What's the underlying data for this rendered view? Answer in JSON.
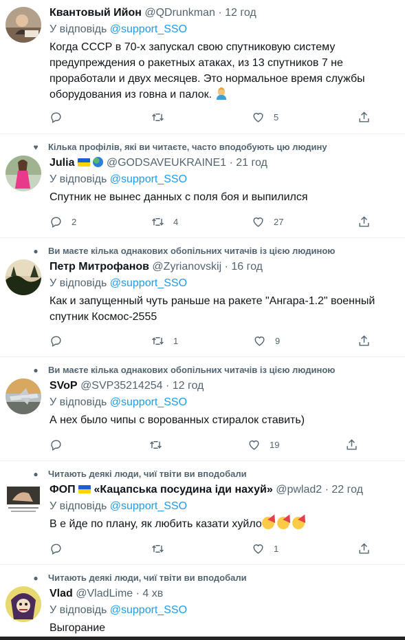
{
  "tweets": [
    {
      "context": "",
      "name": "Квантовый Ийон",
      "handle": "@QDrunkman",
      "time": "· 12 год",
      "reply_prefix": "У відповідь",
      "reply_to": "@support_SSO",
      "text": "Когда СССР в 70-х запускал свою спутниковую систему предупреждения о ракетных атаках, из 13 спутников 7 не проработали и двух месяцев. Это нормальное время службы оборудования из говна и палок.",
      "replies": "",
      "retweets": "",
      "likes": "5"
    },
    {
      "context": "Кілька профілів, які ви читаєте, часто вподобують цю людину",
      "name": "Julia",
      "handle": "@GODSAVEUKRAINE1",
      "time": "· 21 год",
      "reply_prefix": "У відповідь",
      "reply_to": "@support_SSO",
      "text": "Спутник не вынес данных с поля боя и выпилился",
      "replies": "2",
      "retweets": "4",
      "likes": "27"
    },
    {
      "context": "Ви маєте кілька однакових обопільних читачів із цією людиною",
      "name": "Петр Митрофанов",
      "handle": "@Zyrianovskij",
      "time": "· 16 год",
      "reply_prefix": "У відповідь",
      "reply_to": "@support_SSO",
      "text": "Как и запущенный чуть раньше на ракете \"Ангара-1.2\" военный спутник  Космос-2555",
      "replies": "",
      "retweets": "1",
      "likes": "9"
    },
    {
      "context": "Ви маєте кілька однакових обопільних читачів із цією людиною",
      "name": "SVoP",
      "handle": "@SVP35214254",
      "time": "· 12 год",
      "reply_prefix": "У відповідь",
      "reply_to": "@support_SSO",
      "text": "А нех было чипы с ворованных стиралок ставить)",
      "replies": "",
      "retweets": "",
      "likes": "19"
    },
    {
      "context": "Читають деякі люди, чиї твіти ви вподобали",
      "name": "ФОП",
      "name_suffix": "«Кацапська посудина іди нахуй»",
      "handle": "@pwlad2",
      "time": "· 22 год",
      "reply_prefix": "У відповідь",
      "reply_to": "@support_SSO",
      "text": "В е йде по плану, як любить казати хуйло",
      "replies": "",
      "retweets": "",
      "likes": "1"
    },
    {
      "context": "Читають деякі люди, чиї твіти ви вподобали",
      "name": "Vlad",
      "handle": "@VladLime",
      "time": "· 4 хв",
      "reply_prefix": "У відповідь",
      "reply_to": "@support_SSO",
      "text": "Выгорание"
    }
  ],
  "colors": {
    "accent": "#1d9bf0",
    "muted": "#536471",
    "text": "#0f1419",
    "divider": "#eff3f4"
  },
  "icons": [
    "reply-icon",
    "retweet-icon",
    "like-icon",
    "share-icon",
    "heart-context-icon",
    "person-context-icon"
  ]
}
